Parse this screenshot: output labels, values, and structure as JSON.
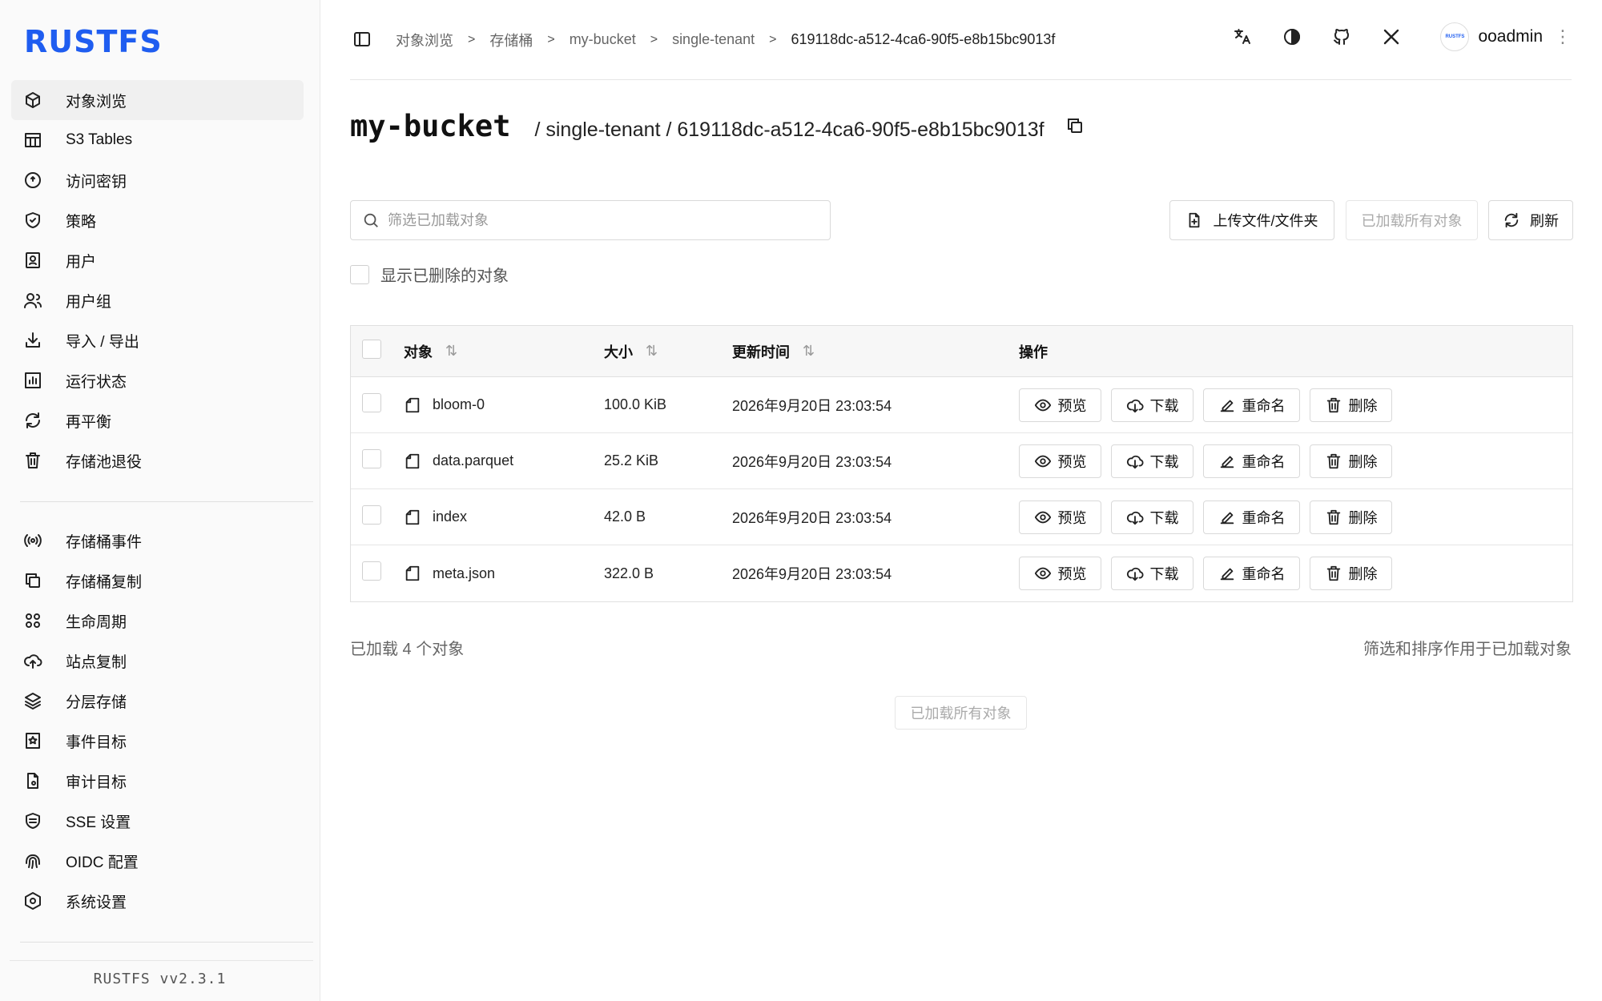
{
  "app": {
    "logo": "RUSTFS",
    "version": "RUSTFS  vv2.3.1"
  },
  "sidebar": {
    "top_items": [
      {
        "label": "对象浏览",
        "icon": "cube-icon",
        "active": true
      },
      {
        "label": "S3 Tables",
        "icon": "table-icon"
      },
      {
        "label": "访问密钥",
        "icon": "key-icon"
      },
      {
        "label": "策略",
        "icon": "shield-icon"
      },
      {
        "label": "用户",
        "icon": "user-icon"
      },
      {
        "label": "用户组",
        "icon": "users-icon"
      },
      {
        "label": "导入 / 导出",
        "icon": "import-export-icon"
      },
      {
        "label": "运行状态",
        "icon": "status-chart-icon"
      },
      {
        "label": "再平衡",
        "icon": "rebalance-icon"
      },
      {
        "label": "存储池退役",
        "icon": "trash-icon"
      }
    ],
    "bottom_items": [
      {
        "label": "存储桶事件",
        "icon": "broadcast-icon"
      },
      {
        "label": "存储桶复制",
        "icon": "copy-icon"
      },
      {
        "label": "生命周期",
        "icon": "lifecycle-icon"
      },
      {
        "label": "站点复制",
        "icon": "cloud-upload-icon"
      },
      {
        "label": "分层存储",
        "icon": "layers-icon"
      },
      {
        "label": "事件目标",
        "icon": "bookmark-star-icon"
      },
      {
        "label": "审计目标",
        "icon": "audit-file-icon"
      },
      {
        "label": "SSE 设置",
        "icon": "sse-lock-icon"
      },
      {
        "label": "OIDC 配置",
        "icon": "fingerprint-icon"
      },
      {
        "label": "系统设置",
        "icon": "settings-hex-icon"
      }
    ]
  },
  "header": {
    "breadcrumbs": [
      "对象浏览",
      "存储桶",
      "my-bucket",
      "single-tenant",
      "619118dc-a512-4ca6-90f5-e8b15bc9013f"
    ],
    "user": {
      "avatar_text": "RUSTFS",
      "name": "ooadmin"
    }
  },
  "page": {
    "bucket": "my-bucket",
    "path": "/ single-tenant / 619118dc-a512-4ca6-90f5-e8b15bc9013f"
  },
  "toolbar": {
    "search_placeholder": "筛选已加载对象",
    "upload_label": "上传文件/文件夹",
    "loaded_all_label": "已加载所有对象",
    "refresh_label": "刷新",
    "show_deleted_label": "显示已删除的对象"
  },
  "table": {
    "headers": {
      "name": "对象",
      "size": "大小",
      "time": "更新时间",
      "ops": "操作"
    },
    "ops": {
      "preview": "预览",
      "download": "下载",
      "rename": "重命名",
      "delete": "删除"
    },
    "rows": [
      {
        "name": "bloom-0",
        "size": "100.0 KiB",
        "time": "2026年9月20日 23:03:54"
      },
      {
        "name": "data.parquet",
        "size": "25.2 KiB",
        "time": "2026年9月20日 23:03:54"
      },
      {
        "name": "index",
        "size": "42.0 B",
        "time": "2026年9月20日 23:03:54"
      },
      {
        "name": "meta.json",
        "size": "322.0 B",
        "time": "2026年9月20日 23:03:54"
      }
    ]
  },
  "footer": {
    "count_text": "已加载 4 个对象",
    "note_text": "筛选和排序作用于已加载对象",
    "loaded_all_label": "已加载所有对象"
  },
  "colors": {
    "brand": "#1f5df0"
  }
}
